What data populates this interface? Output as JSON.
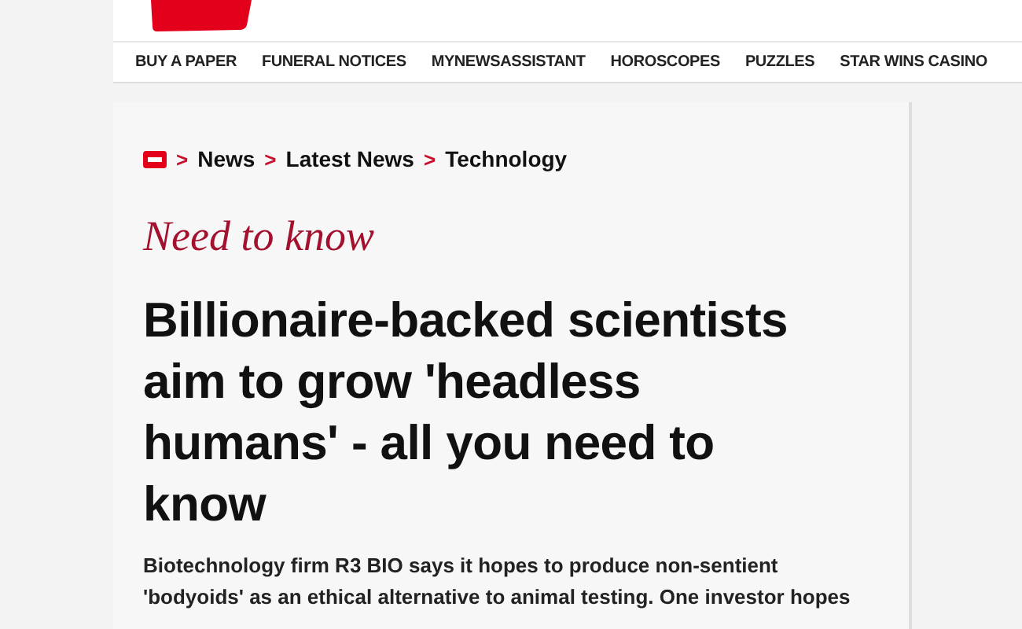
{
  "nav": {
    "items": [
      "BUY A PAPER",
      "FUNERAL NOTICES",
      "MYNEWSASSISTANT",
      "HOROSCOPES",
      "PUZZLES",
      "STAR WINS CASINO"
    ]
  },
  "breadcrumb": {
    "separator": ">",
    "items": [
      "News",
      "Latest News",
      "Technology"
    ]
  },
  "article": {
    "kicker": "Need to know",
    "headline": "Billionaire-backed scientists aim to grow 'headless humans' - all you need to know",
    "summary": "Biotechnology firm R3 BIO says it hopes to produce non-sentient 'bodyoids' as an ethical alternative to animal testing. One investor hopes"
  }
}
